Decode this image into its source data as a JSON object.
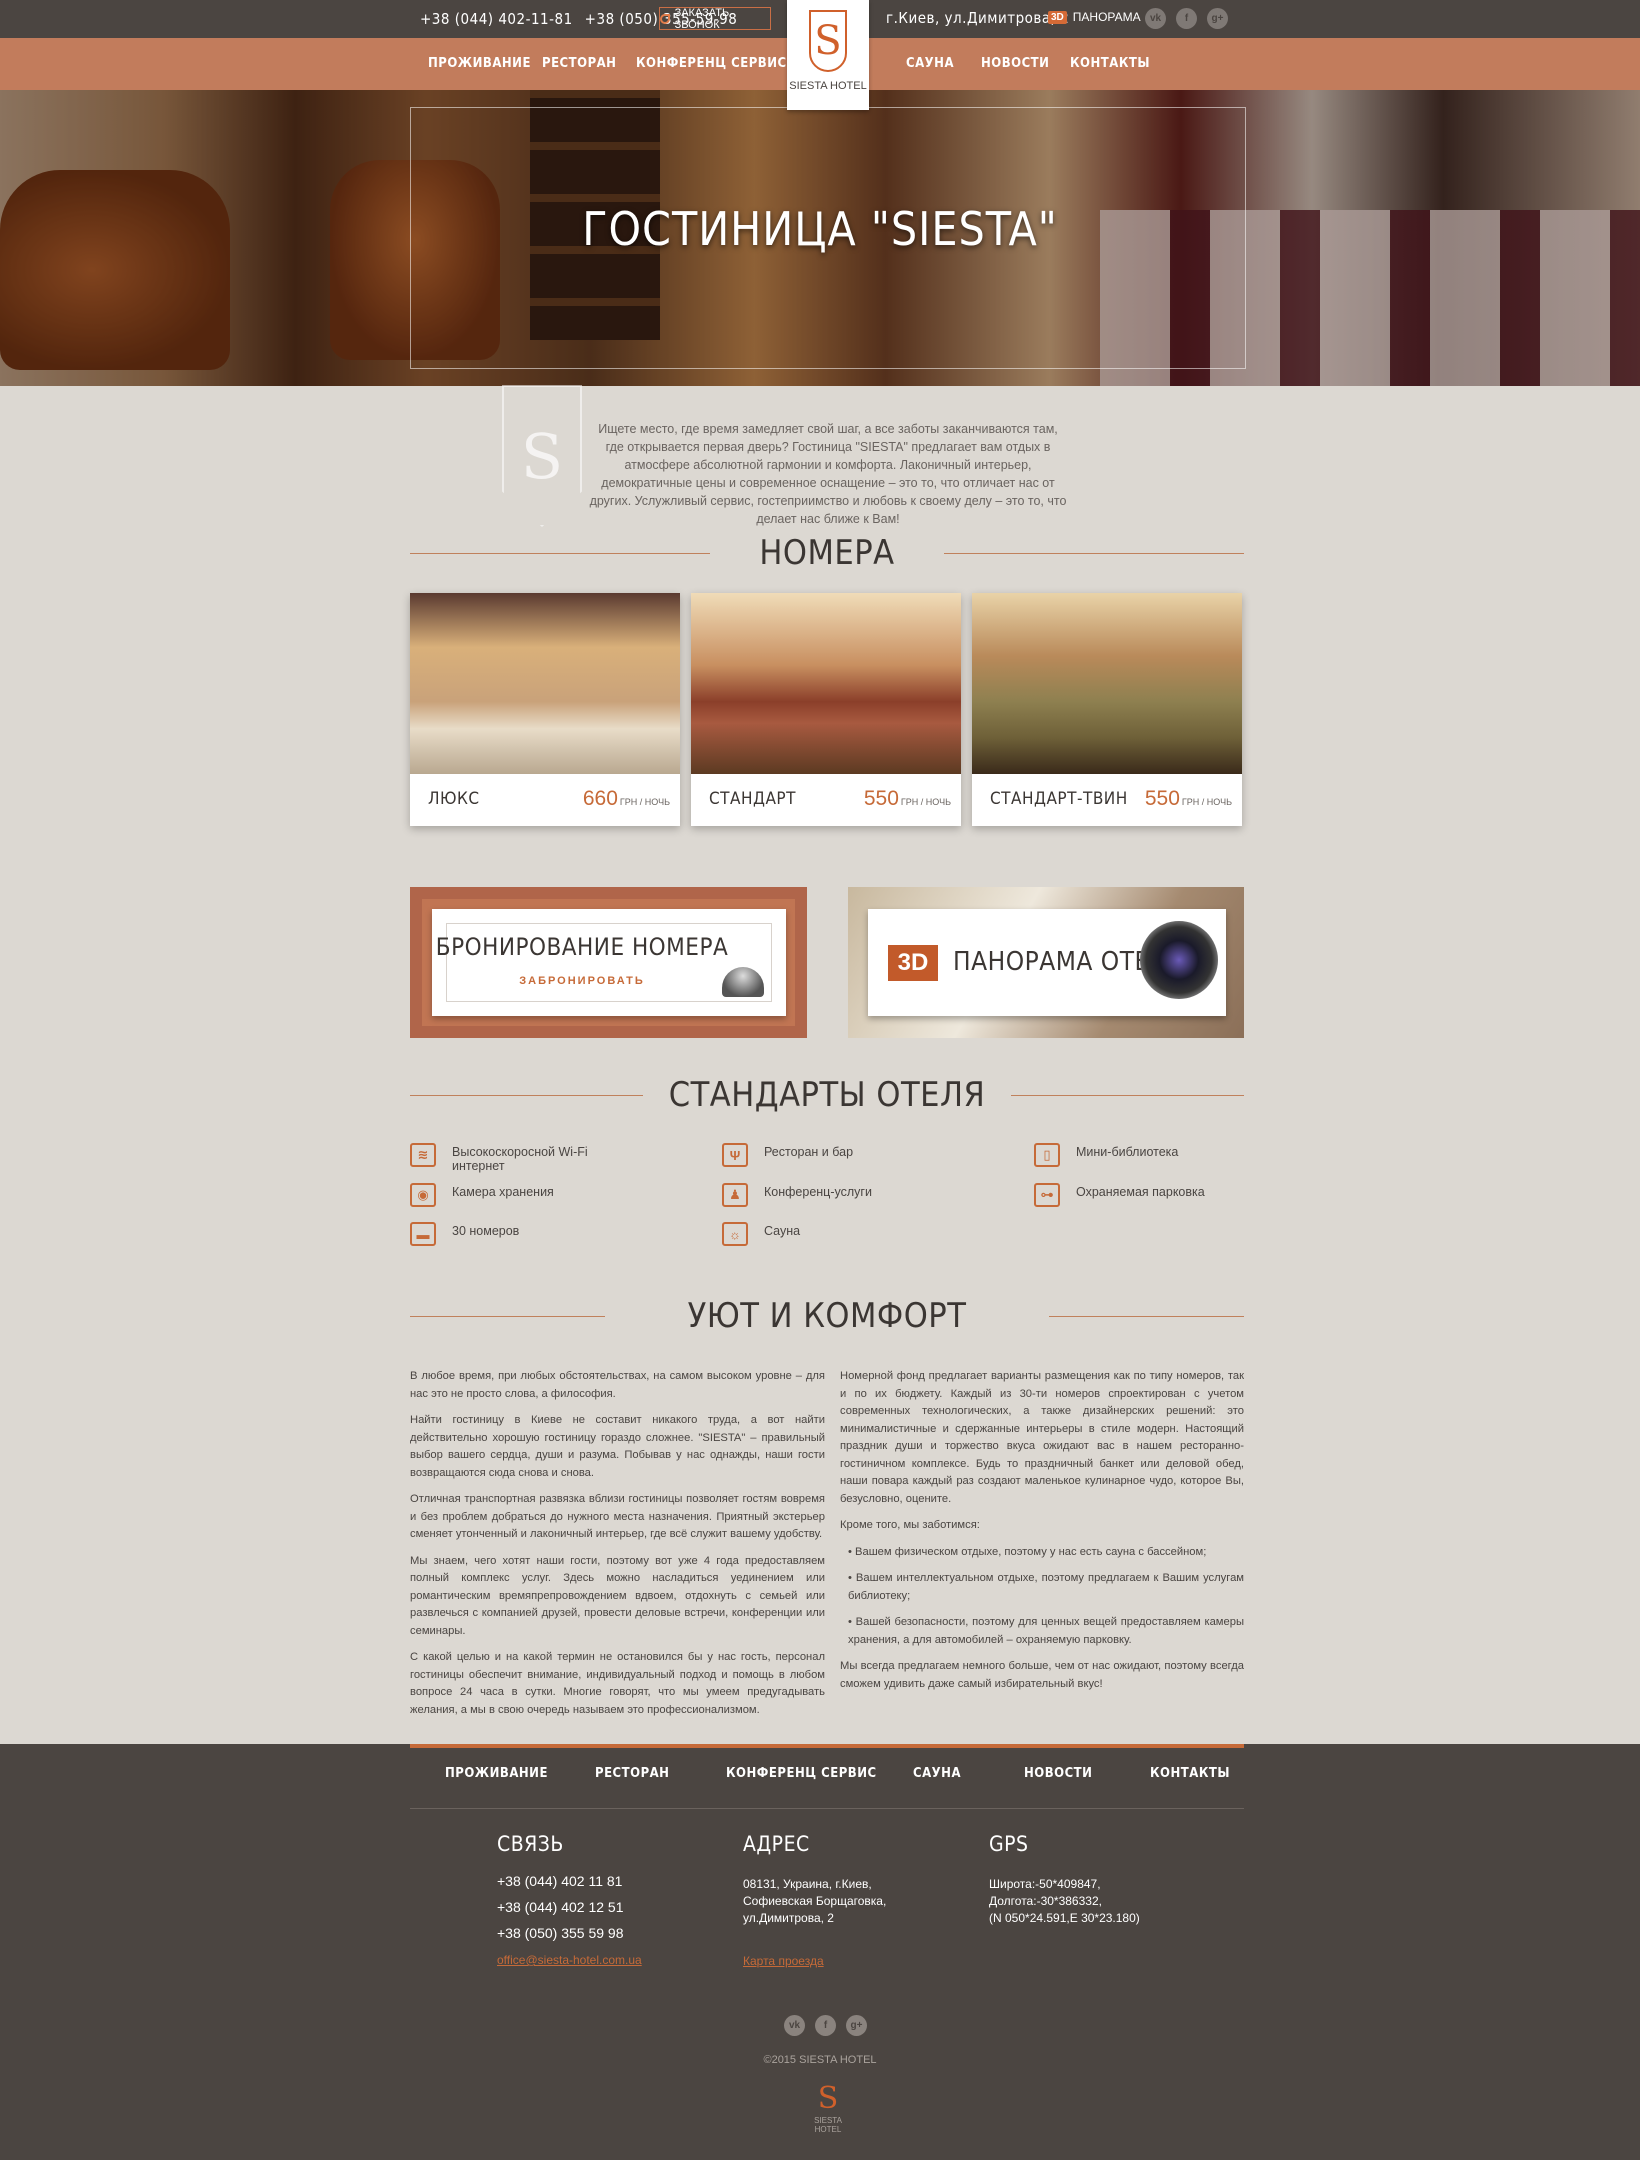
{
  "topbar": {
    "phone1": "+38 (044) 402-11-81",
    "phone2": "+38 (050) 355-59-98",
    "callback": "ЗАКАЗАТЬ ЗВОНОК",
    "address": "г.Киев, ул.Димитрова, 2",
    "panorama_badge": "3D",
    "panorama": "ПАНОРАМА",
    "socials": [
      "vk",
      "f",
      "g+"
    ]
  },
  "nav": {
    "items": [
      "ПРОЖИВАНИЕ",
      "РЕСТОРАН",
      "КОНФЕРЕНЦ СЕРВИС",
      "САУНА",
      "НОВОСТИ",
      "КОНТАКТЫ"
    ],
    "logo_text": "SIESTA HOTEL",
    "logo_letter": "S"
  },
  "hero": {
    "title": "ГОСТИНИЦА \"SIESTA\""
  },
  "intro": {
    "emblem": "S",
    "text": "Ищете место, где время замедляет свой шаг, а все заботы заканчиваются там, где открывается первая дверь? Гостиница \"SIESTA\" предлагает вам отдых в атмосфере абсолютной гармонии и комфорта. Лаконичный интерьер, демократичные цены и современное оснащение – это то, что отличает нас от других. Услужливый сервис, гостеприимство и любовь к своему делу – это то, что делает нас ближе к Вам!"
  },
  "rooms": {
    "title": "НОМЕРА",
    "unit": "ГРН / НОЧЬ",
    "items": [
      {
        "name": "ЛЮКС",
        "price": "660"
      },
      {
        "name": "СТАНДАРТ",
        "price": "550"
      },
      {
        "name": "СТАНДАРТ-ТВИН",
        "price": "550"
      }
    ]
  },
  "promo": {
    "booking_title": "БРОНИРОВАНИЕ НОМЕРА",
    "booking_action": "ЗАБРОНИРОВАТЬ",
    "pano_badge": "3D",
    "pano_title": "ПАНОРАМА ОТЕЛЯ"
  },
  "standards": {
    "title": "СТАНДАРТЫ ОТЕЛЯ",
    "items": [
      {
        "label": "Высокоскоросной Wi-Fi интернет",
        "icon": "wifi-icon"
      },
      {
        "label": "Ресторан и бар",
        "icon": "fork-knife-icon"
      },
      {
        "label": "Мини-библиотека",
        "icon": "book-icon"
      },
      {
        "label": "Камера хранения",
        "icon": "safe-icon"
      },
      {
        "label": "Конференц-услуги",
        "icon": "conference-icon"
      },
      {
        "label": "Охраняемая парковка",
        "icon": "car-icon"
      },
      {
        "label": "30 номеров",
        "icon": "bed-icon"
      },
      {
        "label": "Сауна",
        "icon": "sauna-icon"
      }
    ]
  },
  "comfort": {
    "title": "УЮТ И КОМФОРТ",
    "left": [
      "В любое время, при любых обстоятельствах, на самом высоком уровне – для нас это не просто слова, а философия.",
      "Найти гостиницу в Киеве не составит никакого труда, а вот найти действительно хорошую гостиницу гораздо сложнее. \"SIESTA\" – правильный выбор вашего сердца, души и разума. Побывав у нас однажды, наши гости возвращаются сюда снова и снова.",
      "Отличная транспортная развязка вблизи гостиницы позволяет гостям вовремя и без проблем добраться до нужного места назначения. Приятный экстерьер сменяет утонченный и лаконичный интерьер, где всё служит вашему удобству.",
      "Мы знаем, чего хотят наши гости, поэтому вот уже 4 года предоставляем полный комплекс услуг. Здесь можно насладиться уединением или романтическим времяпрепровождением вдвоем, отдохнуть с семьей или развлечься с компанией друзей, провести деловые встречи, конференции или семинары.",
      "С какой целью и на какой термин не остановился бы у нас гость, персонал гостиницы обеспечит внимание, индивидуальный подход и помощь в любом вопросе 24 часа в сутки. Многие говорят, что мы умеем предугадывать желания, а мы в свою очередь называем это профессионализмом."
    ],
    "right": [
      "Номерной фонд предлагает варианты размещения как по типу номеров, так и по их бюджету. Каждый из 30-ти номеров спроектирован с учетом современных технологических, а также дизайнерских решений: это минималистичные и сдержанные интерьеры в стиле модерн. Настоящий праздник души и торжество вкуса ожидают вас в нашем ресторанно-гостиничном комплексе. Будь то праздничный банкет или деловой обед, наши повара каждый раз создают маленькое кулинарное чудо, которое Вы, безусловно, оцените.",
      "Кроме того, мы заботимся:",
      "• Вашем физическом отдыхе, поэтому у нас есть сауна с бассейном;",
      "• Вашем интеллектуальном отдыхе, поэтому предлагаем к Вашим услугам библиотеку;",
      "• Вашей безопасности, поэтому для ценных вещей предоставляем камеры хранения, а для автомобилей – охраняемую парковку.",
      "Мы всегда предлагаем немного больше, чем от нас ожидают, поэтому всегда сможем удивить даже самый избирательный вкус!"
    ]
  },
  "footer": {
    "nav": [
      "ПРОЖИВАНИЕ",
      "РЕСТОРАН",
      "КОНФЕРЕНЦ СЕРВИС",
      "САУНА",
      "НОВОСТИ",
      "КОНТАКТЫ"
    ],
    "contact_title": "СВЯЗЬ",
    "phones": [
      "+38 (044) 402 11 81",
      "+38 (044) 402 12 51",
      "+38 (050) 355 59 98"
    ],
    "email": "office@siesta-hotel.com.ua",
    "address_title": "АДРЕС",
    "address_lines": [
      "08131, Украина, г.Киев,",
      "Софиевская Борщаговка,",
      "ул.Димитрова, 2"
    ],
    "map_link": "Карта проезда",
    "gps_title": "GPS",
    "gps_lines": [
      "Широта:-50*409847,",
      "Долгота:-30*386332,",
      "(N 050*24.591,E 30*23.180)"
    ],
    "copyright": "©2015 SIESTA HOTEL",
    "logo_letter": "S",
    "logo_text": "SIESTA HOTEL"
  },
  "colors": {
    "accent": "#c66a38",
    "nav": "#c27c5c",
    "dark": "#4b4541",
    "page": "#dcd8d2"
  }
}
